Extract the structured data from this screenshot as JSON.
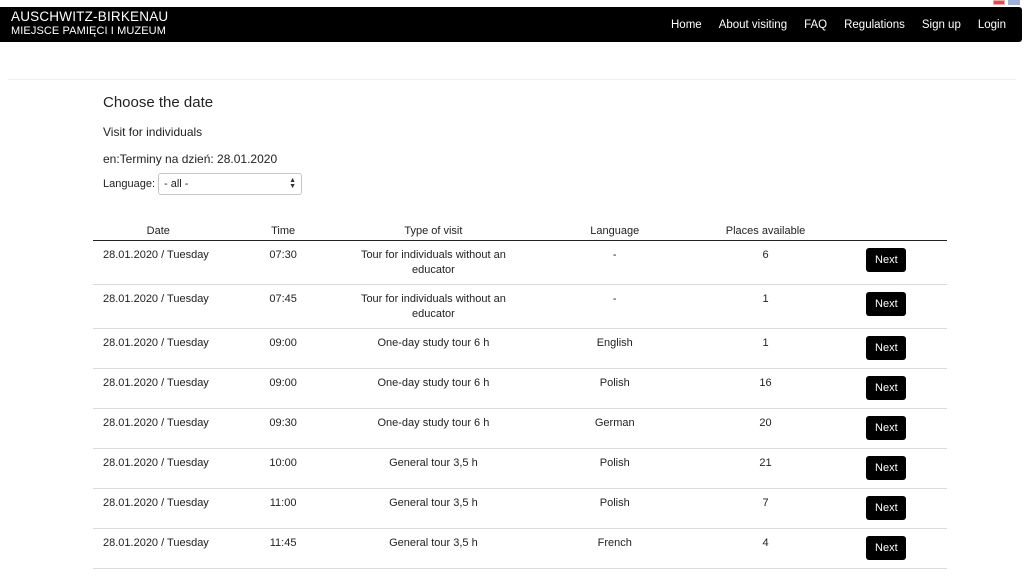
{
  "header": {
    "brand_line1": "AUSCHWITZ-BIRKENAU",
    "brand_line2": "MIEJSCE PAMIĘCI I MUZEUM",
    "nav": [
      "Home",
      "About visiting",
      "FAQ",
      "Regulations",
      "Sign up",
      "Login"
    ]
  },
  "page": {
    "title": "Choose the date",
    "subtitle": "Visit for individuals",
    "date_line": "en:Terminy na dzień: 28.01.2020",
    "language_label": "Language:",
    "language_selected": "- all -"
  },
  "table": {
    "headers": [
      "Date",
      "Time",
      "Type of visit",
      "Language",
      "Places available"
    ],
    "button_label": "Next",
    "rows": [
      {
        "date": "28.01.2020 / Tuesday",
        "time": "07:30",
        "type": "Tour for individuals without an educator",
        "language": "-",
        "places": "6"
      },
      {
        "date": "28.01.2020 / Tuesday",
        "time": "07:45",
        "type": "Tour for individuals without an educator",
        "language": "-",
        "places": "1"
      },
      {
        "date": "28.01.2020 / Tuesday",
        "time": "09:00",
        "type": "One-day study tour 6 h",
        "language": "English",
        "places": "1"
      },
      {
        "date": "28.01.2020 / Tuesday",
        "time": "09:00",
        "type": "One-day study tour 6 h",
        "language": "Polish",
        "places": "16"
      },
      {
        "date": "28.01.2020 / Tuesday",
        "time": "09:30",
        "type": "One-day study tour 6 h",
        "language": "German",
        "places": "20"
      },
      {
        "date": "28.01.2020 / Tuesday",
        "time": "10:00",
        "type": "General tour 3,5 h",
        "language": "Polish",
        "places": "21"
      },
      {
        "date": "28.01.2020 / Tuesday",
        "time": "11:00",
        "type": "General tour 3,5 h",
        "language": "Polish",
        "places": "7"
      },
      {
        "date": "28.01.2020 / Tuesday",
        "time": "11:45",
        "type": "General tour 3,5 h",
        "language": "French",
        "places": "4"
      }
    ]
  }
}
